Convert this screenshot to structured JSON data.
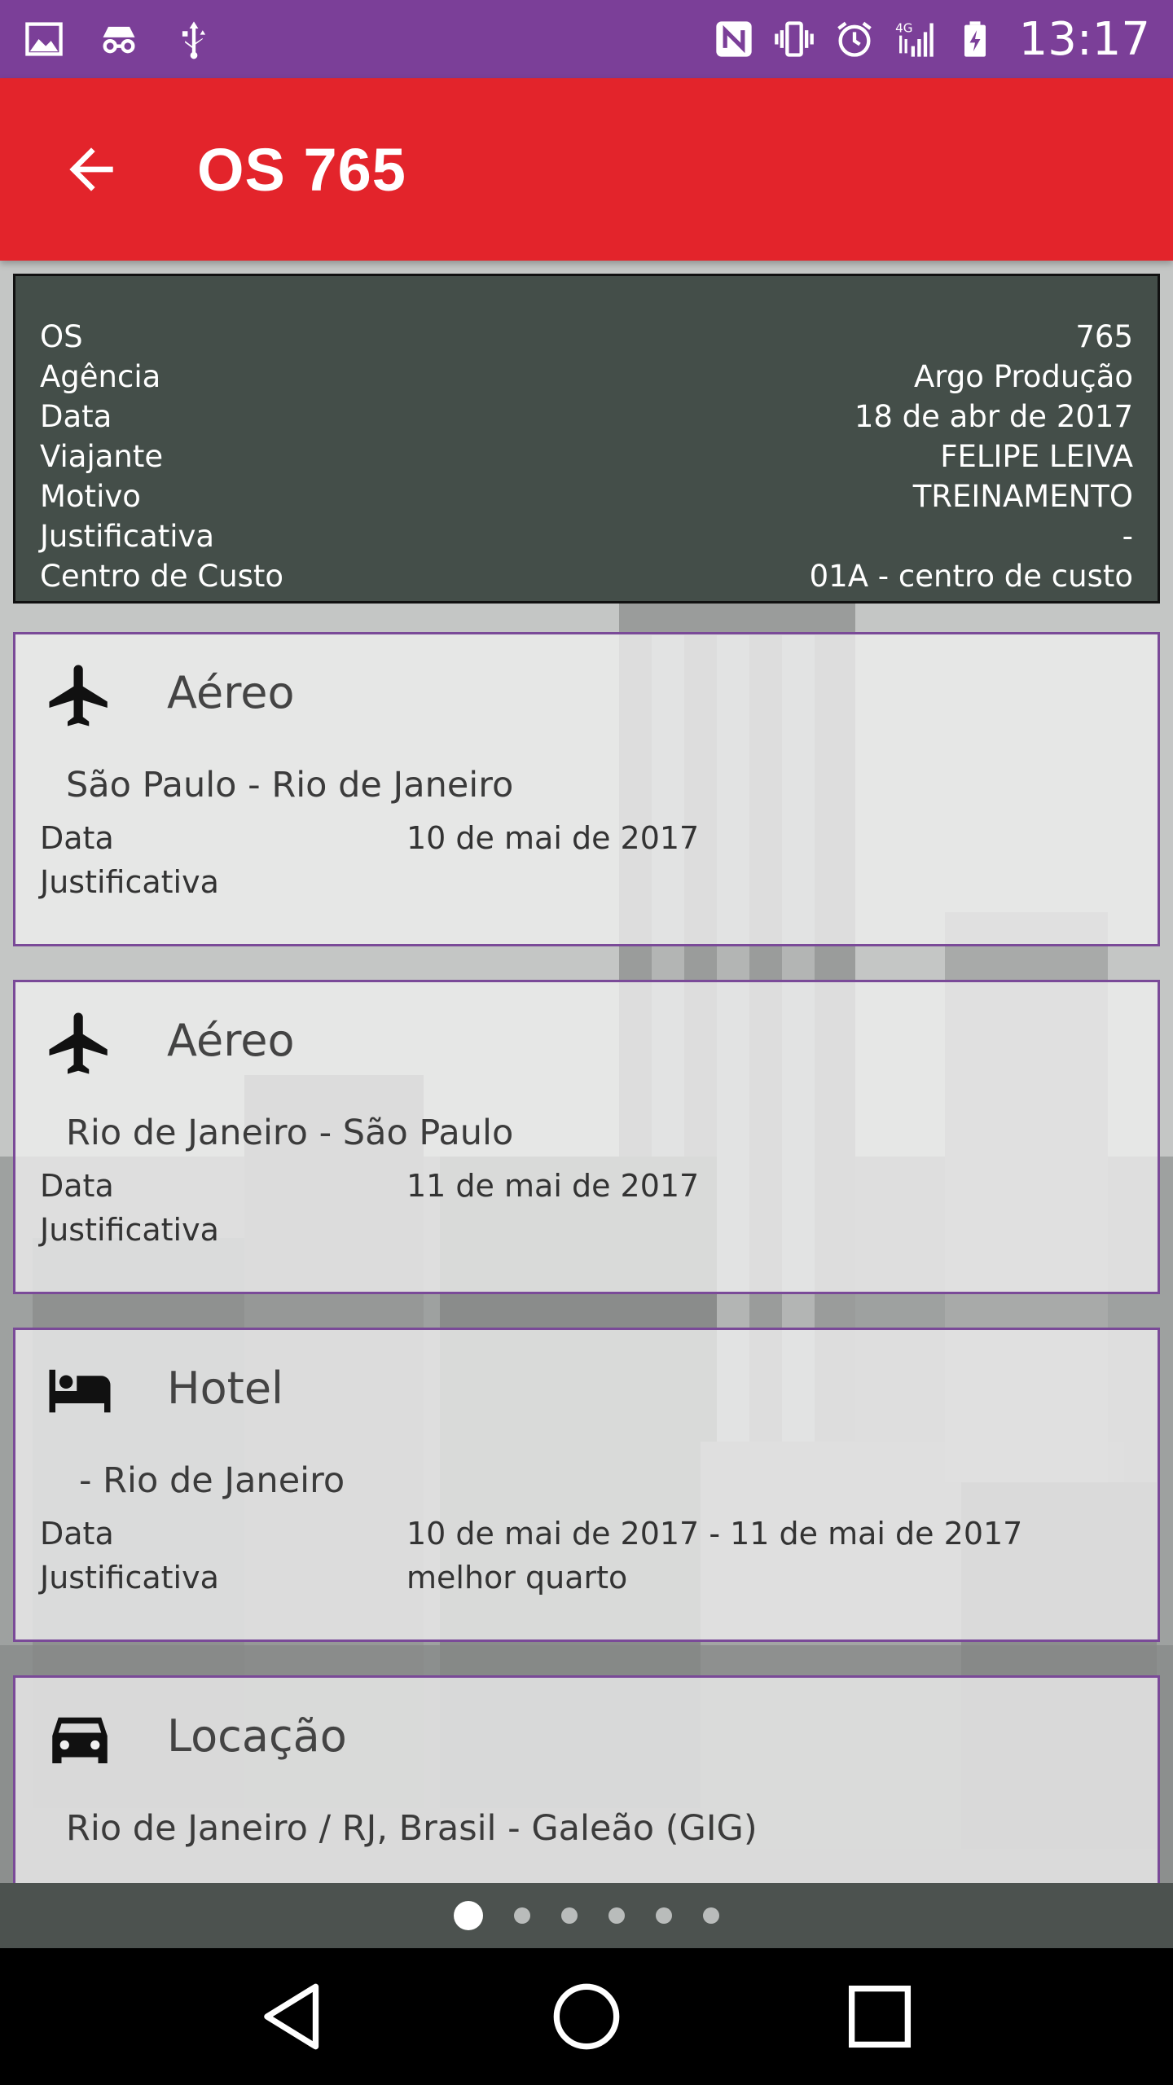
{
  "status_bar": {
    "time": "13:17",
    "network_type": "4G",
    "left_icons": [
      "gallery-icon",
      "incognito-icon",
      "usb-icon"
    ],
    "right_icons": [
      "nfc-icon",
      "vibrate-icon",
      "alarm-icon",
      "signal-icon",
      "battery-charging-icon"
    ],
    "background_color": "#7b3f98"
  },
  "app_bar": {
    "title": "OS 765",
    "background_color": "#e3242b"
  },
  "summary": {
    "rows": [
      {
        "label": "OS",
        "value": "765"
      },
      {
        "label": "Agência",
        "value": "Argo Produção"
      },
      {
        "label": "Data",
        "value": "18 de abr de 2017"
      },
      {
        "label": "Viajante",
        "value": "FELIPE LEIVA"
      },
      {
        "label": "Motivo",
        "value": "TREINAMENTO"
      },
      {
        "label": "Justificativa",
        "value": "-"
      },
      {
        "label": "Centro de Custo",
        "value": "01A - centro de custo"
      }
    ],
    "background_color": "#444e49"
  },
  "cards": [
    {
      "icon": "airplane-icon",
      "category": "Aéreo",
      "route": "São Paulo - Rio de Janeiro",
      "date_label": "Data",
      "date_value": "10 de mai de 2017",
      "justification_label": "Justificativa",
      "justification_value": ""
    },
    {
      "icon": "airplane-icon",
      "category": "Aéreo",
      "route": "Rio de Janeiro - São Paulo",
      "date_label": "Data",
      "date_value": "11 de mai de 2017",
      "justification_label": "Justificativa",
      "justification_value": ""
    },
    {
      "icon": "bed-icon",
      "category": "Hotel",
      "route": " - Rio de Janeiro",
      "date_label": "Data",
      "date_value": "10 de mai de 2017 - 11 de mai de 2017",
      "justification_label": "Justificativa",
      "justification_value": "melhor quarto"
    },
    {
      "icon": "car-icon",
      "category": "Locação",
      "route": "Rio de Janeiro / RJ, Brasil - Galeão (GIG)"
    }
  ],
  "page_indicator": {
    "total": 6,
    "active": 1
  },
  "card_border_color": "#7a4a98"
}
